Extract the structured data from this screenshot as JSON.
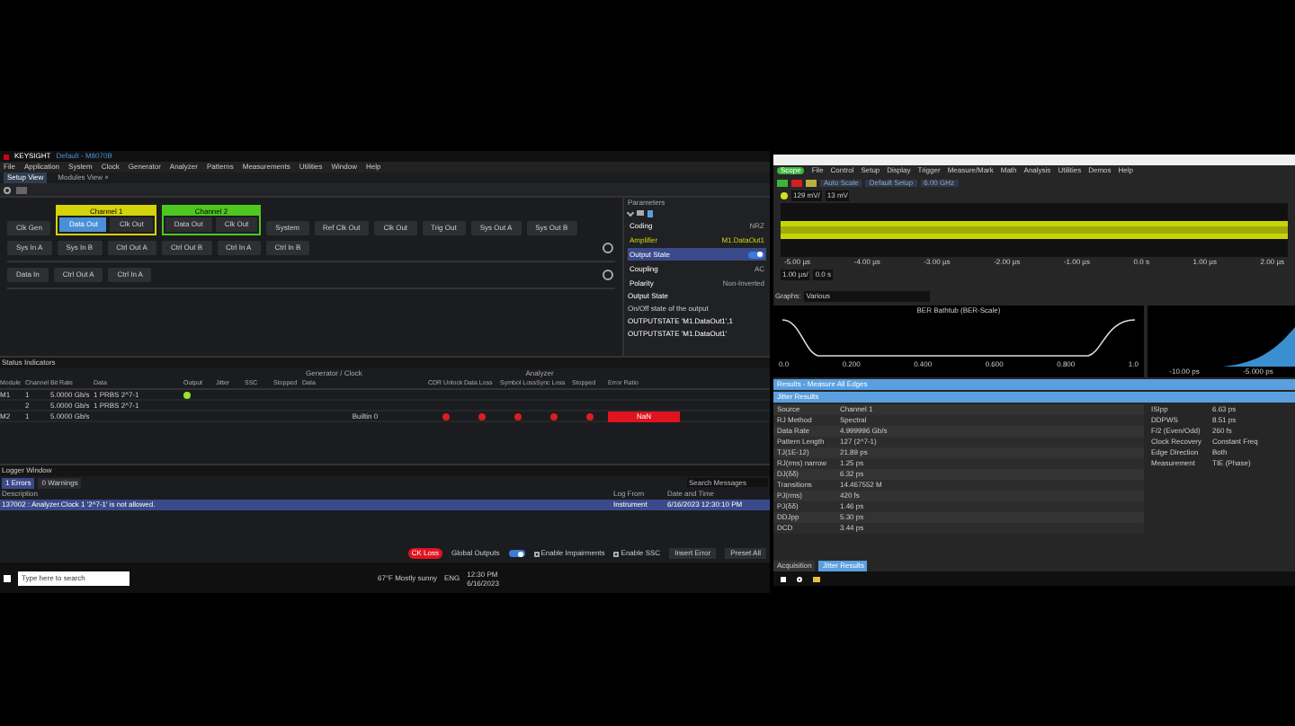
{
  "left_window": {
    "brand": "KEYSIGHT",
    "title": "Default - M8070B",
    "menu": [
      "File",
      "Application",
      "System",
      "Clock",
      "Generator",
      "Analyzer",
      "Patterns",
      "Measurements",
      "Utilities",
      "Window",
      "Help"
    ],
    "tabs": [
      {
        "label": "Setup View",
        "selected": true
      },
      {
        "label": "Modules View",
        "selected": false,
        "close": "×"
      }
    ],
    "module_rows": [
      {
        "items": [
          {
            "kind": "button",
            "label": "Clk Gen",
            "selected": false
          },
          {
            "kind": "group",
            "title": "Channel 1",
            "color": "#d4d40a",
            "items": [
              {
                "label": "Data Out",
                "selected": true
              },
              {
                "label": "Clk Out",
                "selected": false
              }
            ]
          },
          {
            "kind": "group",
            "title": "Channel 2",
            "color": "#4cc81e",
            "items": [
              {
                "label": "Data Out",
                "selected": false
              },
              {
                "label": "Clk Out",
                "selected": false
              }
            ]
          },
          {
            "kind": "button",
            "label": "System",
            "selected": false
          },
          {
            "kind": "button",
            "label": "Ref Clk Out",
            "selected": false
          },
          {
            "kind": "button",
            "label": "Clk Out",
            "selected": false
          },
          {
            "kind": "button",
            "label": "Trig Out",
            "selected": false
          },
          {
            "kind": "button",
            "label": "Sys Out A",
            "selected": false
          },
          {
            "kind": "button",
            "label": "Sys Out B",
            "selected": false
          },
          {
            "kind": "button",
            "label": "Sys In A",
            "selected": false
          },
          {
            "kind": "button",
            "label": "Sys In B",
            "selected": false
          },
          {
            "kind": "button",
            "label": "Ctrl Out A",
            "selected": false
          },
          {
            "kind": "button",
            "label": "Ctrl Out B",
            "selected": false
          },
          {
            "kind": "button",
            "label": "Ctrl In A",
            "selected": false
          },
          {
            "kind": "button",
            "label": "Ctrl In B",
            "selected": false
          }
        ]
      },
      {
        "items": [
          {
            "kind": "button",
            "label": "Data In",
            "selected": false
          },
          {
            "kind": "button",
            "label": "Ctrl Out A",
            "selected": false
          },
          {
            "kind": "button",
            "label": "Ctrl In A",
            "selected": false
          }
        ]
      }
    ],
    "parameters": {
      "title": "Parameters",
      "rows": [
        {
          "kind": "value",
          "label": "Coding",
          "value": "NRZ",
          "selected": false
        },
        {
          "kind": "header",
          "label": "Amplifier",
          "value": "M1.DataOut1",
          "selected": false
        },
        {
          "kind": "switch",
          "label": "Output State",
          "on": true,
          "selected": true
        },
        {
          "kind": "value",
          "label": "Coupling",
          "value": "AC",
          "selected": false
        },
        {
          "kind": "value",
          "label": "Polarity",
          "value": "Non-Inverted",
          "selected": false
        }
      ],
      "help_title": "Output State",
      "help_text": "On/Off state of the output",
      "help_commands": [
        "OUTPUTSTATE 'M1.DataOut1',1",
        "OUTPUTSTATE 'M1.DataOut1'"
      ]
    },
    "status": {
      "title": "Status Indicators",
      "groups": [
        "Generator / Clock",
        "Analyzer"
      ],
      "columns": [
        "Module",
        "Channel",
        "Bit Rate",
        "Data",
        "Output",
        "Jitter",
        "SSC",
        "Stopped",
        "Data",
        "CDR Unlock",
        "Data Loss",
        "Symbol Loss",
        "Sync Loss",
        "Stopped",
        "Error Ratio"
      ],
      "rows": [
        {
          "module": "M1",
          "channel": "1",
          "rate": "5.0000 Gb/s",
          "gen_data": "1 PRBS 2^7-1",
          "output_on": true,
          "analyzer": false
        },
        {
          "module": "",
          "channel": "2",
          "rate": "5.0000 Gb/s",
          "gen_data": "1 PRBS 2^7-1",
          "output_on": false,
          "analyzer": false
        },
        {
          "module": "M2",
          "channel": "1",
          "rate": "5.0000 Gb/s",
          "ana_data": "Builtin 0",
          "output_on": false,
          "analyzer": true,
          "error_ratio": "NaN"
        }
      ]
    },
    "logger": {
      "title": "Logger Window",
      "tabs": [
        {
          "label": "1 Errors",
          "selected": true
        },
        {
          "label": "0 Warnings",
          "selected": false
        }
      ],
      "search": {
        "placeholder": "Search Messages"
      },
      "columns": [
        "Description",
        "Log From",
        "Date and Time"
      ],
      "rows": [
        {
          "description": "137002 : Analyzer.Clock 1 '2^7-1' is not allowed.",
          "from": "Instrument",
          "time": "6/16/2023 12:30:10 PM",
          "selected": true
        }
      ]
    },
    "footer": {
      "loss": "CK Loss",
      "global_outputs": {
        "label": "Global Outputs",
        "on": true
      },
      "checks": [
        {
          "label": "Enable Impairments",
          "checked": false
        },
        {
          "label": "Enable SSC",
          "checked": false
        }
      ],
      "buttons": [
        "Insert Error",
        "Preset All"
      ]
    },
    "taskbar": {
      "search": {
        "placeholder": "Type here to search"
      },
      "weather": "67°F  Mostly sunny",
      "lang": "ENG",
      "time": "12:30 PM",
      "date": "6/16/2023"
    }
  },
  "right_window": {
    "menu": [
      {
        "label": "Scope",
        "selected": true
      },
      {
        "label": "File",
        "selected": false
      },
      {
        "label": "Control",
        "selected": false
      },
      {
        "label": "Setup",
        "selected": false
      },
      {
        "label": "Display",
        "selected": false
      },
      {
        "label": "Trigger",
        "selected": false
      },
      {
        "label": "Measure/Mark",
        "selected": false
      },
      {
        "label": "Math",
        "selected": false
      },
      {
        "label": "Analysis",
        "selected": false
      },
      {
        "label": "Utilities",
        "selected": false
      },
      {
        "label": "Demos",
        "selected": false
      },
      {
        "label": "Help",
        "selected": false
      }
    ],
    "toolbar": [
      "Auto Scale",
      "Default Setup",
      "6.00 GHz"
    ],
    "channel": {
      "scale": "129 mV/",
      "offset": "13 mV"
    },
    "time_labels": [
      "-5.00 µs",
      "-4.00 µs",
      "-3.00 µs",
      "-2.00 µs",
      "-1.00 µs",
      "0.0 s",
      "1.00 µs",
      "2.00 µs"
    ],
    "timebase": {
      "scale": "1.00 µs/",
      "position": "0.0 s"
    },
    "graphs": {
      "label": "Graphs:",
      "value": "Various"
    },
    "bathtub": {
      "title": "BER Bathtub (BER-Scale)",
      "x_labels": [
        "0.0",
        "0.200",
        "0.400",
        "0.600",
        "0.800",
        "1.0"
      ]
    },
    "histogram": {
      "x_labels": [
        "-10.00 ps",
        "-5.000 ps"
      ]
    },
    "bars": [
      "Results - Measure All Edges",
      "Jitter Results"
    ],
    "results_left": [
      [
        "Source",
        "Channel 1"
      ],
      [
        "RJ Method",
        "Spectral"
      ],
      [
        "Data Rate",
        "4.999996 Gb/s"
      ],
      [
        "Pattern Length",
        "127 (2^7-1)"
      ],
      [
        "TJ(1E-12)",
        "21.89 ps"
      ],
      [
        "RJ(rms) narrow",
        "1.25 ps"
      ],
      [
        "DJ(δδ)",
        "6.32 ps"
      ],
      [
        "Transitions",
        "14.467552 M"
      ],
      [
        "PJ(rms)",
        "420 fs"
      ],
      [
        "PJ(δδ)",
        "1.46 ps"
      ],
      [
        "DDJpp",
        "5.30 ps"
      ],
      [
        "DCD",
        "3.44 ps"
      ]
    ],
    "results_right": [
      [
        "ISIpp",
        "6.63 ps"
      ],
      [
        "DDPWS",
        "8.51 ps"
      ],
      [
        "F/2 (Even/Odd)",
        "260 fs"
      ],
      [
        "Clock Recovery",
        "Constant Freq"
      ],
      [
        "Edge Direction",
        "Both"
      ],
      [
        "Measurement",
        "TIE (Phase)"
      ]
    ],
    "bottom_tabs": [
      {
        "label": "Acquisition",
        "selected": false
      },
      {
        "label": "Jitter Results",
        "selected": true
      }
    ]
  }
}
